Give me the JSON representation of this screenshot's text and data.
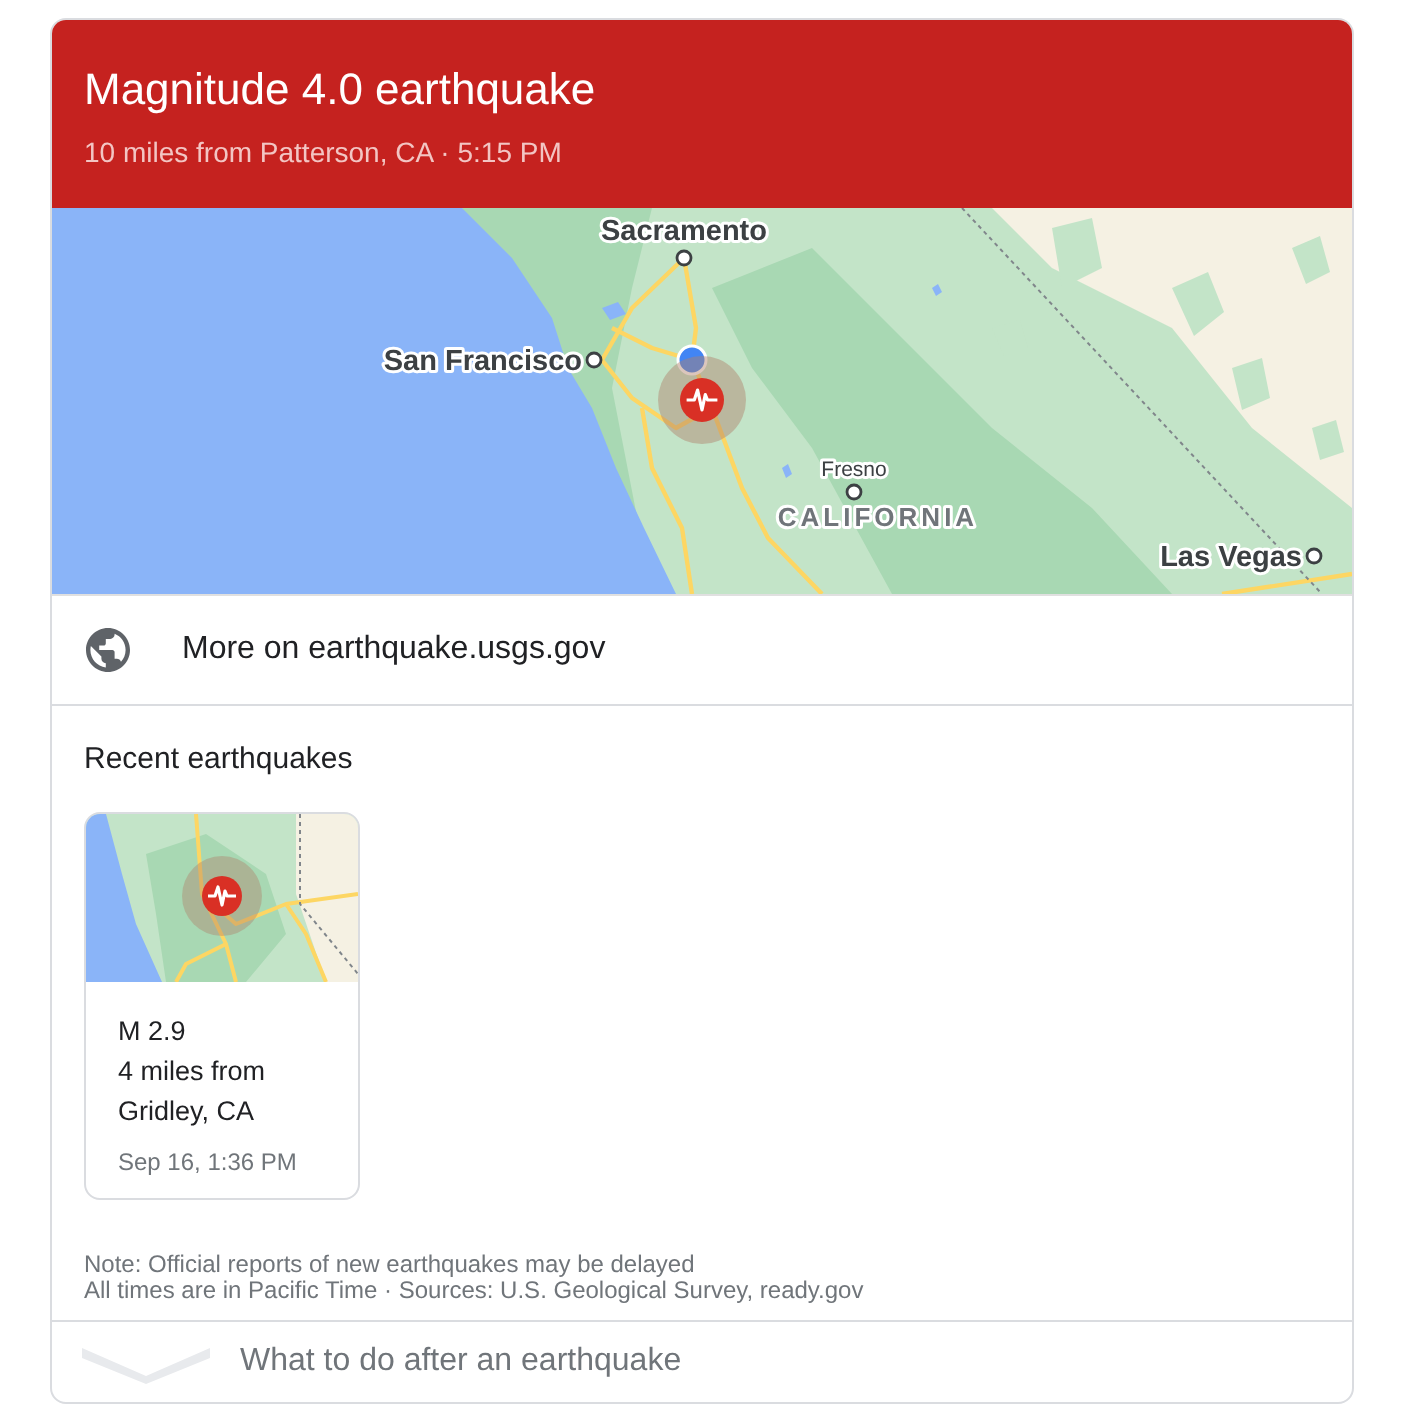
{
  "header": {
    "title": "Magnitude 4.0 earthquake",
    "subtitle": "10 miles from Patterson, CA · 5:15 PM"
  },
  "map": {
    "labels": [
      {
        "kind": "major_city",
        "text": "Sacramento"
      },
      {
        "kind": "major_city",
        "text": "San Francisco"
      },
      {
        "kind": "city",
        "text": "Fresno"
      },
      {
        "kind": "region",
        "text": "CALIFORNIA"
      },
      {
        "kind": "major_city",
        "text": "Las Vegas"
      }
    ]
  },
  "link": {
    "text": "More on earthquake.usgs.gov"
  },
  "recent": {
    "heading": "Recent earthquakes",
    "items": [
      {
        "magnitude": "M 2.9",
        "location": "4 miles from Gridley, CA",
        "time": "Sep 16, 1:36 PM"
      }
    ]
  },
  "notes": [
    "Note: Official reports of new earthquakes may be delayed",
    "All times are in Pacific Time · Sources: U.S. Geological Survey, ready.gov"
  ],
  "footer": {
    "text": "What to do after an earthquake"
  }
}
